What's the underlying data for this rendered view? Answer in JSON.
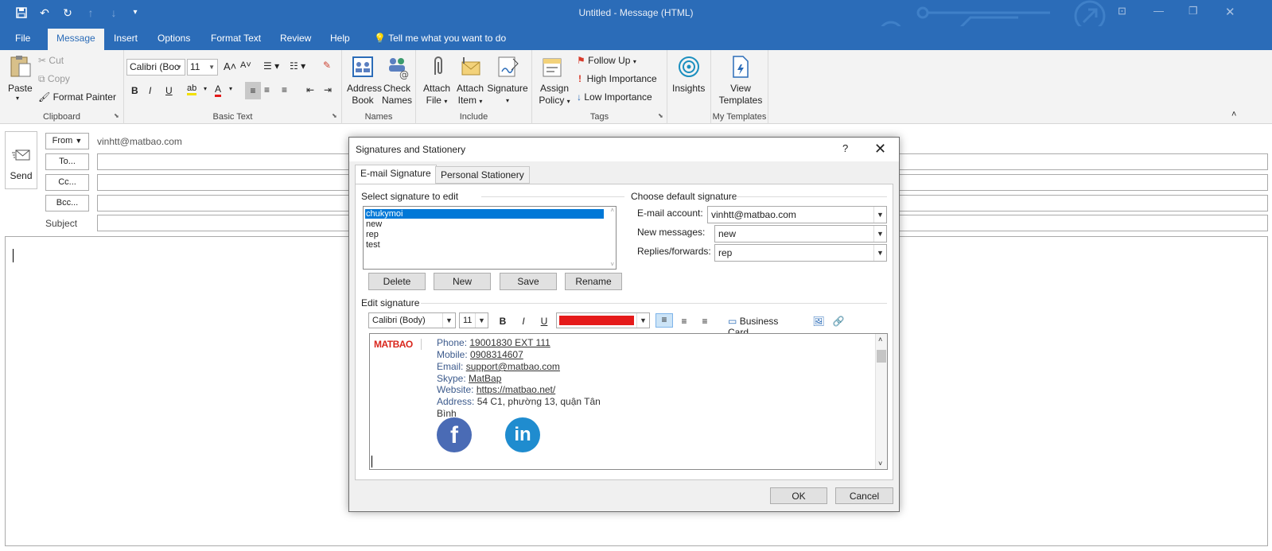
{
  "window": {
    "title": "Untitled  -  Message (HTML)"
  },
  "ribbon_tabs": [
    "File",
    "Message",
    "Insert",
    "Options",
    "Format Text",
    "Review",
    "Help"
  ],
  "tell_me": "Tell me what you want to do",
  "clipboard": {
    "paste": "Paste",
    "cut": "Cut",
    "copy": "Copy",
    "format_painter": "Format Painter",
    "label": "Clipboard"
  },
  "basic_text": {
    "font": "Calibri (Boc",
    "size": "11",
    "bold": "B",
    "italic": "I",
    "underline": "U",
    "label": "Basic Text"
  },
  "names": {
    "address_book_1": "Address",
    "address_book_2": "Book",
    "check_names_1": "Check",
    "check_names_2": "Names",
    "label": "Names"
  },
  "include": {
    "attach_file_1": "Attach",
    "attach_file_2": "File",
    "attach_item_1": "Attach",
    "attach_item_2": "Item",
    "signature": "Signature",
    "label": "Include"
  },
  "tags": {
    "assign_policy_1": "Assign",
    "assign_policy_2": "Policy",
    "follow_up": "Follow Up",
    "high": "High Importance",
    "low": "Low Importance",
    "label": "Tags"
  },
  "insights": {
    "label": "Insights"
  },
  "templates": {
    "view_1": "View",
    "view_2": "Templates",
    "label": "My Templates"
  },
  "compose": {
    "send": "Send",
    "from_btn": "From",
    "from_value": "vinhtt@matbao.com",
    "to_btn": "To...",
    "cc_btn": "Cc...",
    "bcc_btn": "Bcc...",
    "subject_label": "Subject"
  },
  "dialog": {
    "title": "Signatures and Stationery",
    "help": "?",
    "close": "✕",
    "tabs": [
      "E-mail Signature",
      "Personal Stationery"
    ],
    "select_label": "Select signature to edit",
    "signatures": [
      "chukymoi",
      "new",
      "rep",
      "test"
    ],
    "buttons": {
      "delete": "Delete",
      "new": "New",
      "save": "Save",
      "rename": "Rename"
    },
    "default_label": "Choose default signature",
    "account_label": "E-mail account:",
    "account_value": "vinhtt@matbao.com",
    "new_messages_label": "New messages:",
    "new_messages_value": "new",
    "replies_label": "Replies/forwards:",
    "replies_value": "rep",
    "edit_label": "Edit signature",
    "editor_font": "Calibri (Body)",
    "editor_size": "11",
    "business_card": "Business Card",
    "font_color": "#e51a1a",
    "logo": "MATBAO",
    "signature_lines": [
      {
        "label": "Phone: ",
        "value": "19001830 EXT 111",
        "link": true
      },
      {
        "label": "Mobile: ",
        "value": "0908314607",
        "link": true
      },
      {
        "label": "Email: ",
        "value": "support@matbao.com",
        "link": true
      },
      {
        "label": "Skype: ",
        "value": "MatBap",
        "link": true
      },
      {
        "label": "Website: ",
        "value": "https://matbao.net/",
        "link": true
      },
      {
        "label": "Address: ",
        "value": "54 C1, phường 13, quận Tân",
        "link": false
      }
    ],
    "address_cont": "Bình",
    "social": {
      "facebook": "f",
      "linkedin": "in"
    },
    "ok": "OK",
    "cancel": "Cancel"
  },
  "colors": {
    "brand_blue": "#2b6cb8",
    "selection": "#0078d7",
    "facebook": "#4a6bb5",
    "linkedin": "#1f8ccf"
  }
}
